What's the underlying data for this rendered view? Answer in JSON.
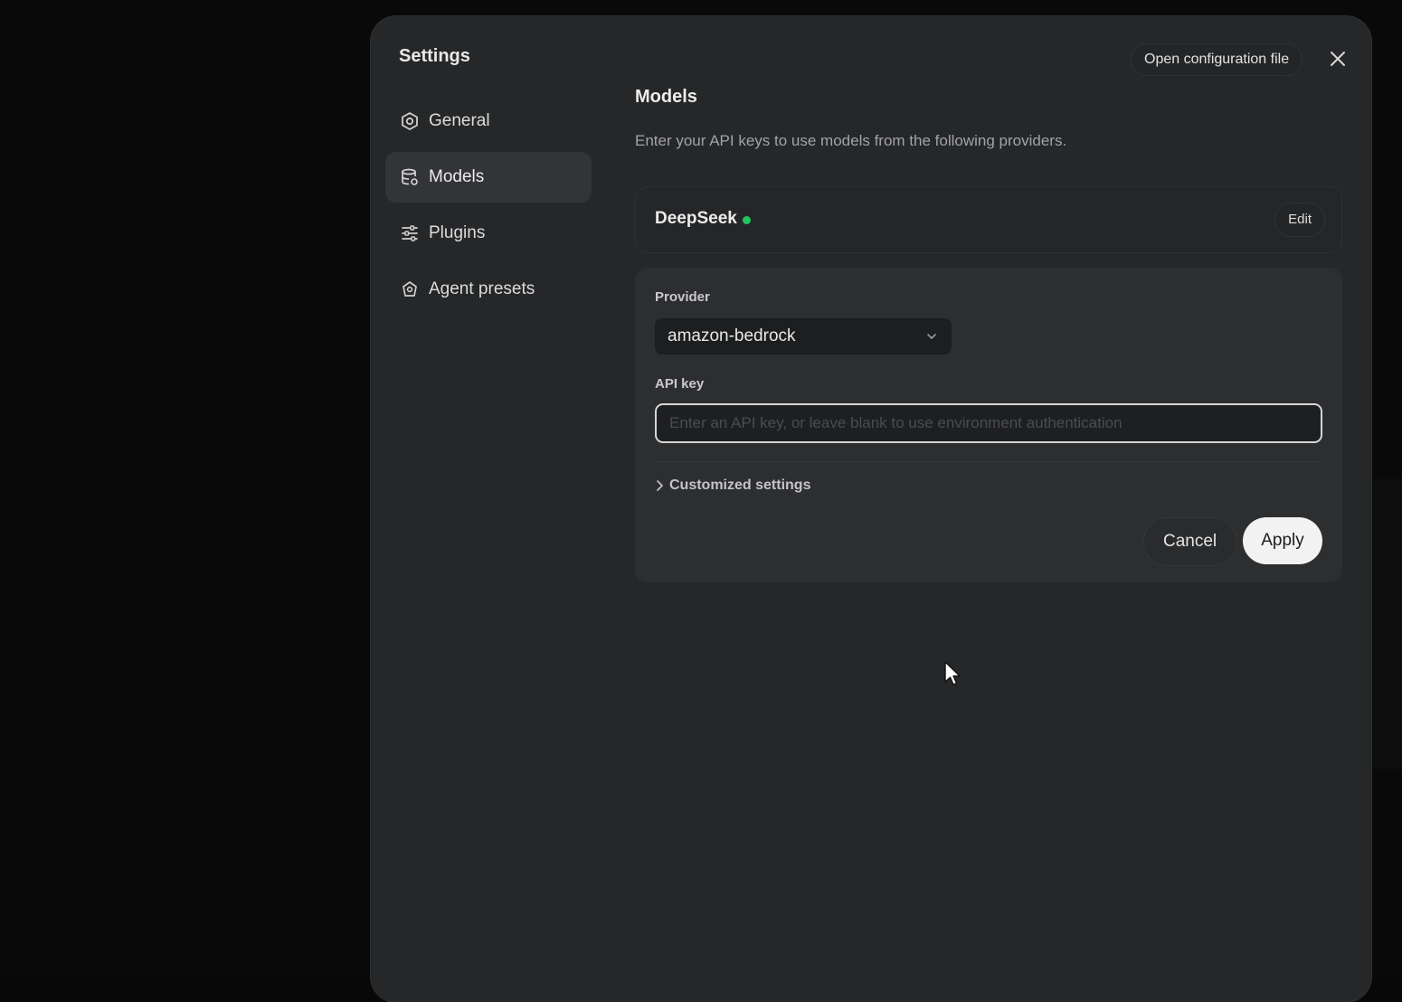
{
  "dialog": {
    "title": "Settings",
    "open_config_label": "Open configuration file"
  },
  "sidebar": {
    "items": [
      {
        "label": "General",
        "icon": "gear-icon",
        "active": false
      },
      {
        "label": "Models",
        "icon": "database-icon",
        "active": true
      },
      {
        "label": "Plugins",
        "icon": "sliders-icon",
        "active": false
      },
      {
        "label": "Agent presets",
        "icon": "agent-icon",
        "active": false
      }
    ]
  },
  "main": {
    "title": "Models",
    "description": "Enter your API keys to use models from the following providers.",
    "providers": [
      {
        "name": "DeepSeek",
        "status_color": "#22c55e",
        "edit_label": "Edit"
      }
    ],
    "edit_form": {
      "provider_label": "Provider",
      "provider_value": "amazon-bedrock",
      "api_key_label": "API key",
      "api_key_value": "",
      "api_key_placeholder": "Enter an API key, or leave blank to use environment authentication",
      "customized_label": "Customized settings",
      "cancel_label": "Cancel",
      "apply_label": "Apply"
    }
  },
  "colors": {
    "background": "#090909",
    "panel": "#262729",
    "accent_status": "#22c55e"
  }
}
